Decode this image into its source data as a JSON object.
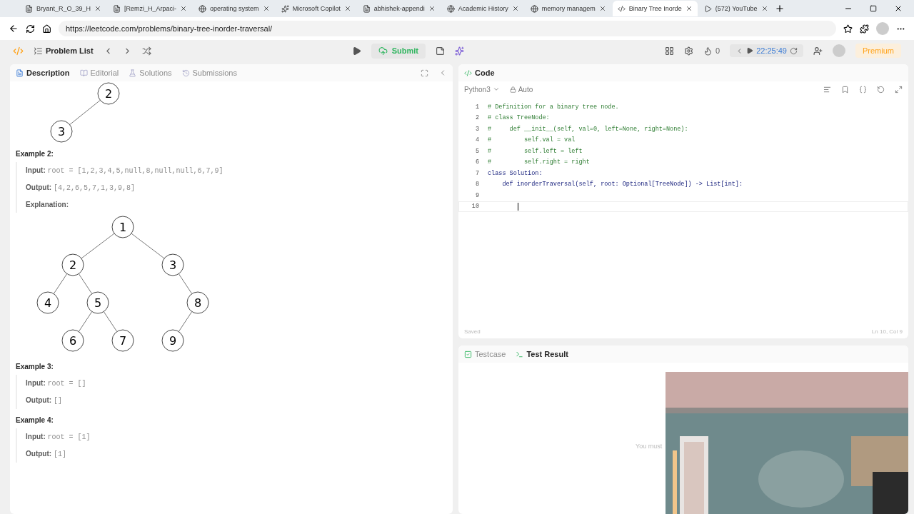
{
  "browser": {
    "tabs": [
      {
        "title": "Bryant_R_O_39_H",
        "selected": false
      },
      {
        "title": "[Remzi_H_Arpaci-",
        "selected": false
      },
      {
        "title": "operating system",
        "selected": false
      },
      {
        "title": "Microsoft Copilot",
        "selected": false
      },
      {
        "title": "abhishek-appendi",
        "selected": false
      },
      {
        "title": "Academic History",
        "selected": false
      },
      {
        "title": "memory managem",
        "selected": false
      },
      {
        "title": "Binary Tree Inorde",
        "selected": true
      },
      {
        "title": "(572) YouTube",
        "selected": false
      }
    ],
    "url": "https://leetcode.com/problems/binary-tree-inorder-traversal/"
  },
  "navbar": {
    "problem_list": "Problem List",
    "submit": "Submit",
    "streak": "0",
    "timer": "22:25:49",
    "premium": "Premium"
  },
  "left_tabs": [
    {
      "label": "Description",
      "selected": true
    },
    {
      "label": "Editorial",
      "selected": false
    },
    {
      "label": "Solutions",
      "selected": false
    },
    {
      "label": "Submissions",
      "selected": false
    }
  ],
  "description": [
    {
      "kind": "tree",
      "tree": {
        "label": "2",
        "left": {
          "label": "3"
        }
      }
    },
    {
      "kind": "heading",
      "text": "Example 2:"
    },
    {
      "kind": "io",
      "label": "Input:",
      "value": "root = [1,2,3,4,5,null,8,null,null,6,7,9]"
    },
    {
      "kind": "io",
      "label": "Output:",
      "value": "[4,2,6,5,7,1,3,9,8]"
    },
    {
      "kind": "io",
      "label": "Explanation:"
    },
    {
      "kind": "tree",
      "tree": {
        "label": "1",
        "left": {
          "label": "2",
          "left": {
            "label": "4"
          },
          "right": {
            "label": "5",
            "left": {
              "label": "6"
            },
            "right": {
              "label": "7"
            }
          }
        },
        "right": {
          "label": "3",
          "right": {
            "label": "8",
            "left": {
              "label": "9"
            }
          }
        }
      }
    },
    {
      "kind": "heading",
      "text": "Example 3:"
    },
    {
      "kind": "io",
      "label": "Input:",
      "value": "root = []"
    },
    {
      "kind": "io",
      "label": "Output:",
      "value": "[]"
    },
    {
      "kind": "heading",
      "text": "Example 4:"
    },
    {
      "kind": "io",
      "label": "Input:",
      "value": "root = [1]"
    },
    {
      "kind": "io",
      "label": "Output:",
      "value": "[1]"
    }
  ],
  "editor": {
    "title": "Code",
    "language": "Python3",
    "mode": "Auto",
    "lines": [
      {
        "number": "1",
        "kind": "comment",
        "text": "# Definition for a binary tree node."
      },
      {
        "number": "2",
        "kind": "comment",
        "text": "# class TreeNode:"
      },
      {
        "number": "3",
        "kind": "comment",
        "text": "#     def __init__(self, val=0, left=None, right=None):"
      },
      {
        "number": "4",
        "kind": "comment",
        "text": "#         self.val = val"
      },
      {
        "number": "5",
        "kind": "comment",
        "text": "#         self.left = left"
      },
      {
        "number": "6",
        "kind": "comment",
        "text": "#         self.right = right"
      },
      {
        "number": "7",
        "kind": "code",
        "text": "class Solution:"
      },
      {
        "number": "8",
        "kind": "code",
        "text": "    def inorderTraversal(self, root: Optional[TreeNode]) -> List[int]:"
      },
      {
        "number": "9",
        "kind": "code"
      },
      {
        "number": "10",
        "kind": "cursor"
      }
    ],
    "status": "Saved",
    "position": "Ln 10, Col 9"
  },
  "bottom_tabs": [
    {
      "label": "Testcase",
      "selected": false
    },
    {
      "label": "Test Result",
      "selected": true
    }
  ],
  "result_message": "You must"
}
